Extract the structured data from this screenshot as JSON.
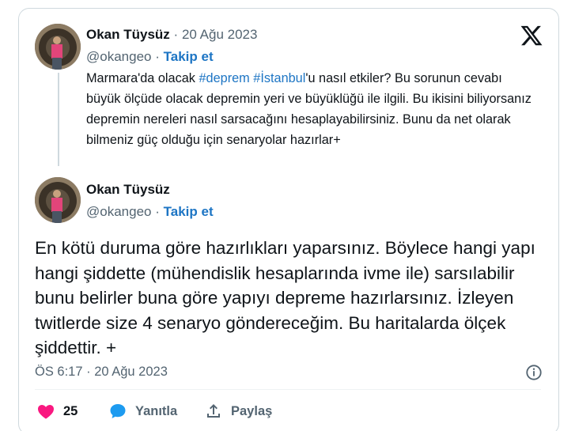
{
  "quoted_tweet": {
    "author_name": "Okan Tüysüz",
    "separator": "·",
    "date": "20 Ağu 2023",
    "handle": "@okangeo",
    "follow_label": "Takip et",
    "text_parts": {
      "p1": "Marmara'da olacak ",
      "tag1": "#deprem",
      "space": " ",
      "tag2": "#İstanbul",
      "p2": "'u nasıl etkiler? Bu sorunun cevabı büyük ölçüde olacak depremin yeri ve büyüklüğü ile ilgili. Bu ikisini biliyorsanız depremin nereleri nasıl sarsacağını hesaplayabilirsiniz. Bunu da net olarak bilmeniz güç olduğu için senaryolar hazırlar+"
    }
  },
  "main_tweet": {
    "author_name": "Okan Tüysüz",
    "handle": "@okangeo",
    "separator": "·",
    "follow_label": "Takip et",
    "text": "En kötü duruma göre hazırlıkları yaparsınız. Böylece hangi yapı hangi şiddette (mühendislik hesaplarında  ivme ile) sarsılabilir bunu belirler buna göre yapıyı depreme hazırlarsınız. İzleyen twitlerde size 4 senaryo göndereceğim. Bu haritalarda ölçek şiddettir. +",
    "timestamp": "ÖS 6:17 · 20 Ağu 2023"
  },
  "actions": {
    "like_count": "25",
    "reply_label": "Yanıtla",
    "share_label": "Paylaş"
  },
  "icons": {
    "logo": "x-logo-icon",
    "info": "info-icon",
    "like": "heart-icon",
    "reply": "speech-bubble-icon",
    "share": "share-icon"
  },
  "colors": {
    "link": "#1d9bf0",
    "follow": "#1d75c4",
    "like": "#f91880",
    "reply": "#1d9bf0",
    "muted": "#536471"
  }
}
